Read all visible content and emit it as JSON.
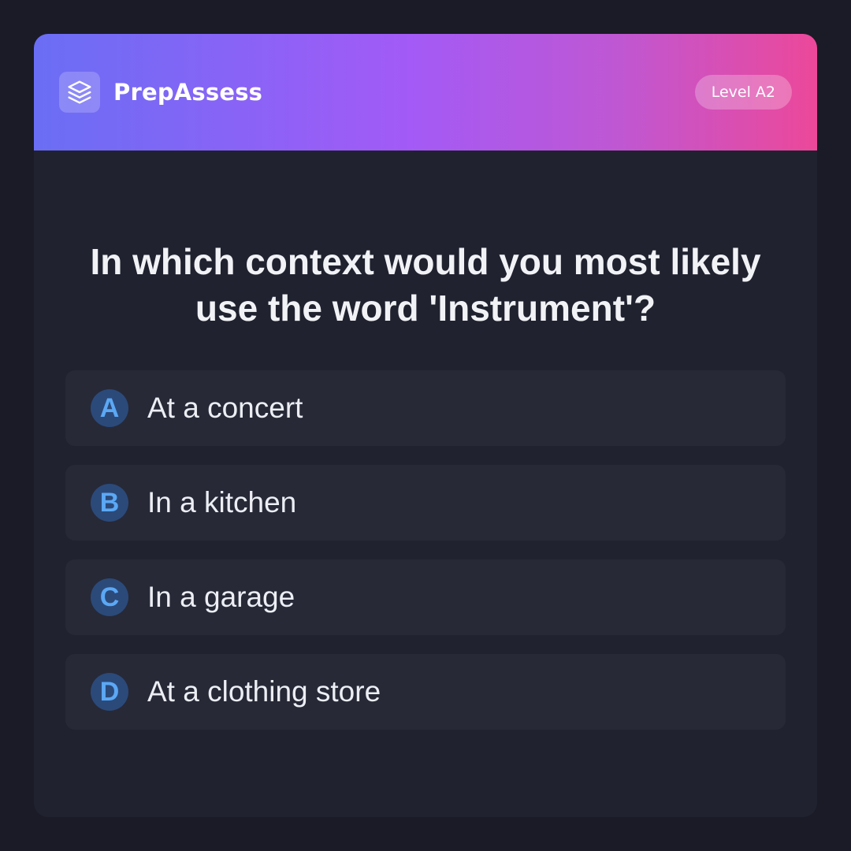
{
  "header": {
    "brand_name": "PrepAssess",
    "logo_icon": "layers-icon",
    "level_badge": "Level A2",
    "gradient_colors": [
      "#6a6ef5",
      "#a35af6",
      "#ec4899"
    ]
  },
  "quiz": {
    "question": "In which context would you most likely use the word 'Instrument'?",
    "options": [
      {
        "letter": "A",
        "text": "At a concert"
      },
      {
        "letter": "B",
        "text": "In a kitchen"
      },
      {
        "letter": "C",
        "text": "In a garage"
      },
      {
        "letter": "D",
        "text": "At a clothing store"
      }
    ]
  },
  "colors": {
    "page_background": "#1a1b26",
    "card_background": "#20222f",
    "option_background": "#272937",
    "letter_accent": "#5ba8f5"
  }
}
